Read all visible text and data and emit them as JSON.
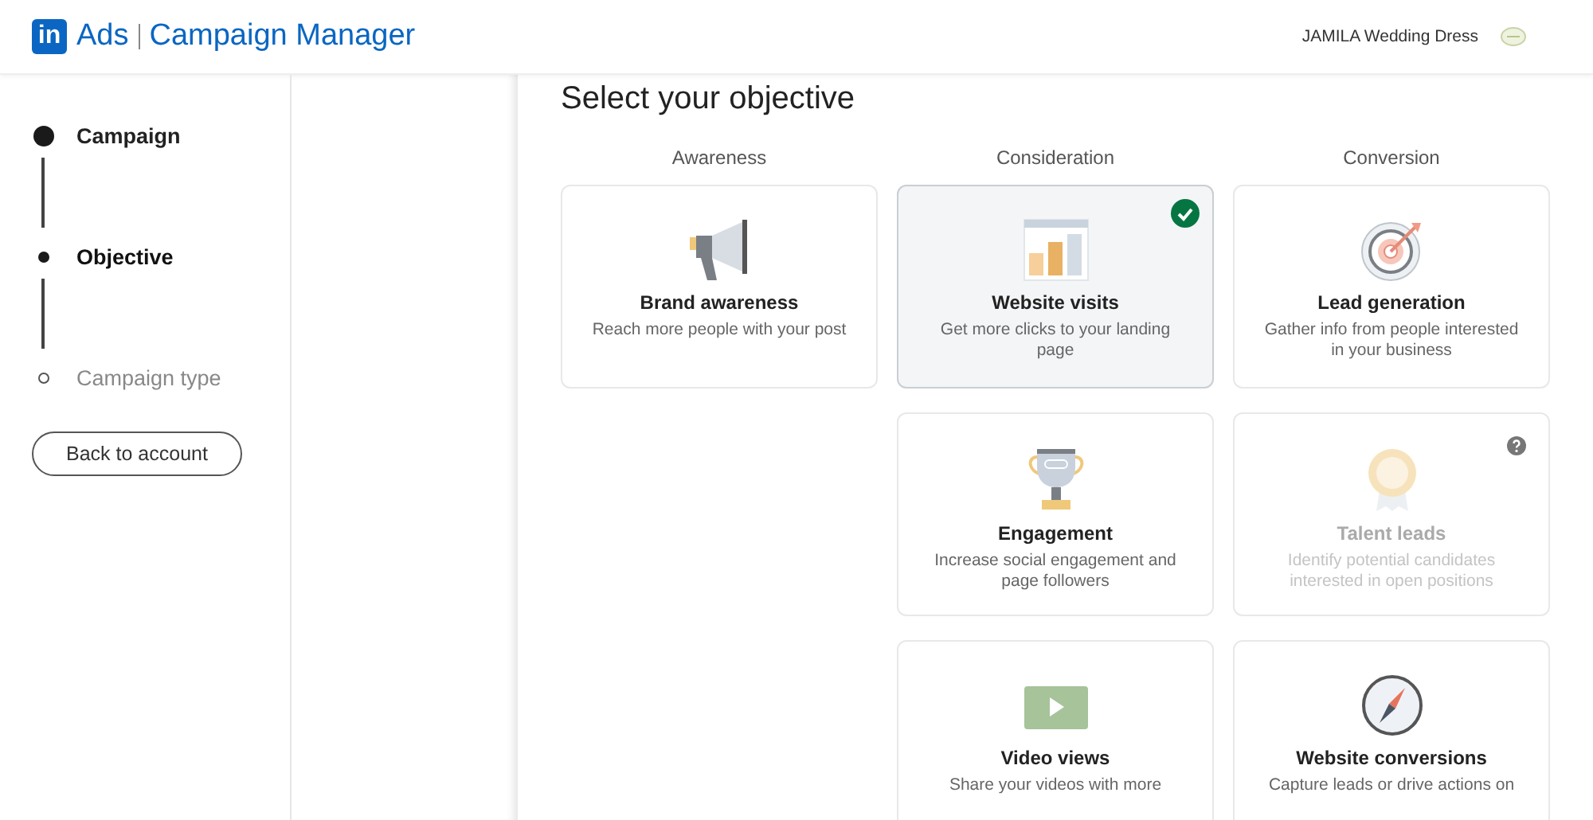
{
  "header": {
    "brand": "in",
    "product": "Ads",
    "app": "Campaign Manager",
    "account": "JAMILA Wedding Dress"
  },
  "steps": [
    {
      "label": "Campaign",
      "done": true,
      "selected": false
    },
    {
      "label": "Objective",
      "done": false,
      "selected": true
    },
    {
      "label": "Campaign type",
      "done": false,
      "selected": false
    }
  ],
  "back_button": "Back to account",
  "title": "Select your objective",
  "columns": [
    {
      "heading": "Awareness",
      "cards": [
        {
          "kind": "megaphone",
          "title": "Brand awareness",
          "description": "Reach more people with your post",
          "selected": false,
          "disabled": false,
          "help": false
        }
      ]
    },
    {
      "heading": "Consideration",
      "cards": [
        {
          "kind": "chart",
          "title": "Website visits",
          "description": "Get more clicks to your landing page",
          "selected": true,
          "disabled": false,
          "help": false
        },
        {
          "kind": "trophy",
          "title": "Engagement",
          "description": "Increase social engagement and page followers",
          "selected": false,
          "disabled": false,
          "help": false
        },
        {
          "kind": "video",
          "title": "Video views",
          "description": "Share your videos with more",
          "selected": false,
          "disabled": false,
          "help": false
        }
      ]
    },
    {
      "heading": "Conversion",
      "cards": [
        {
          "kind": "target",
          "title": "Lead generation",
          "description": "Gather info from people interested in your business",
          "selected": false,
          "disabled": false,
          "help": false
        },
        {
          "kind": "medal",
          "title": "Talent leads",
          "description": "Identify potential candidates interested in open positions",
          "selected": false,
          "disabled": true,
          "help": true
        },
        {
          "kind": "compass",
          "title": "Website conversions",
          "description": "Capture leads or drive actions on",
          "selected": false,
          "disabled": false,
          "help": false
        }
      ]
    }
  ]
}
